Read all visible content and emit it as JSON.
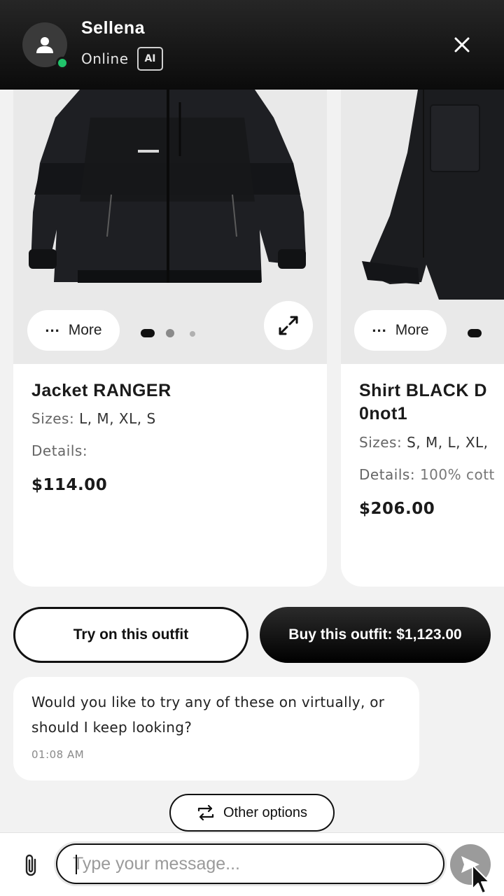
{
  "header": {
    "agent_name": "Sellena",
    "status": "Online",
    "badge": "AI",
    "status_color": "#21c46b",
    "close_icon": "close-icon"
  },
  "products": [
    {
      "title": "Jacket RANGER",
      "sizes_label": "Sizes:",
      "sizes": "L, M, XL, S",
      "details_label": "Details:",
      "details": "",
      "price": "$114.00",
      "more_label": "More",
      "image_count": 3,
      "active_image": 1
    },
    {
      "title_line1": "Shirt BLACK D",
      "title_line2": "0not1",
      "sizes_label": "Sizes:",
      "sizes": "S, M, L, XL,",
      "details_label": "Details:",
      "details": "100% cott",
      "price": "$206.00",
      "more_label": "More"
    }
  ],
  "actions": {
    "try_on": "Try on this outfit",
    "buy": "Buy this outfit: $1,123.00"
  },
  "message": {
    "text": "Would you like to try any of these on virtually, or should I keep looking?",
    "time": "01:08 AM"
  },
  "other_options": "Other options",
  "composer": {
    "placeholder": "Type your message..."
  }
}
